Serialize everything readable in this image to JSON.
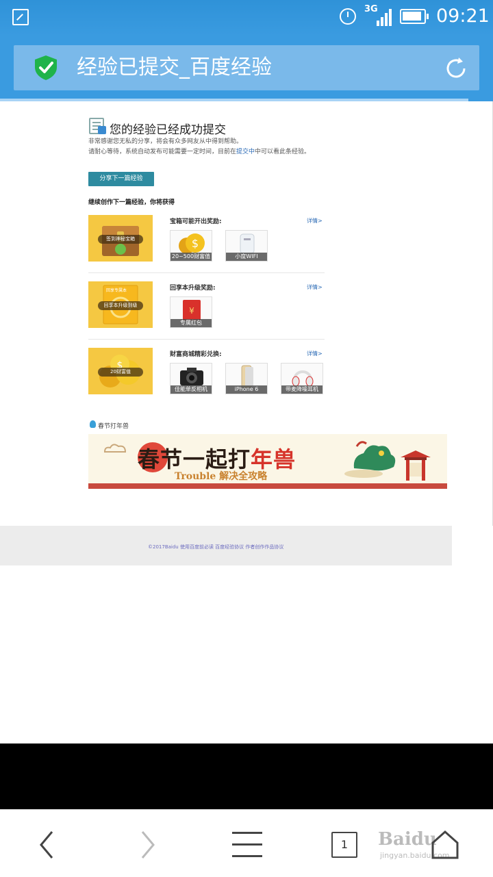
{
  "status_bar": {
    "network": "3G",
    "time": "09:21"
  },
  "url_bar": {
    "title": "经验已提交_百度经验"
  },
  "main": {
    "success_title": "您的经验已经成功提交",
    "thanks_line": "非常感谢您无私的分享，将会有众多网友从中得到帮助。",
    "wait_line_prefix": "请耐心等待，系统自动发布可能需要一定时间，目前在",
    "wait_line_link": "提交中",
    "wait_line_suffix": "中可以看此条经验。",
    "share_button": "分享下一篇经验",
    "continue_heading": "继续创作下一篇经验，你将获得"
  },
  "rewards": [
    {
      "banner_label": "签到神秘宝箱",
      "title": "宝箱可能开出奖励:",
      "detail": "详情>",
      "prizes": [
        "20~500财富值",
        "小度WIFI"
      ]
    },
    {
      "banner_label": "回享本升级到级",
      "banner_top_label": "回享专属本",
      "title": "回享本升级奖励:",
      "detail": "详情>",
      "prizes": [
        "专属红包"
      ]
    },
    {
      "banner_label": "20财富值",
      "title": "财富商城精彩兑换:",
      "detail": "详情>",
      "prizes": [
        "佳能单反相机",
        "iPhone 6",
        "带麦降噪耳机"
      ]
    }
  ],
  "spring": {
    "label": "春节打年兽",
    "headline_black": "春节一起打",
    "headline_red": "年兽",
    "subline": "Trouble 解决全攻略"
  },
  "footer": {
    "text": "©2017Baidu  使用百度前必读  百度经验协议  作者创作作品协议"
  },
  "bottom_nav": {
    "tab_count": "1",
    "watermark": "Baidu",
    "watermark_url": "jingyan.baidu.com"
  },
  "colors": {
    "status_bar": "#2f92d8",
    "url_bar": "#3a9be0",
    "share_button": "#2e8ba0",
    "link": "#2a6ab5",
    "reward_banner": "#f5c842"
  }
}
